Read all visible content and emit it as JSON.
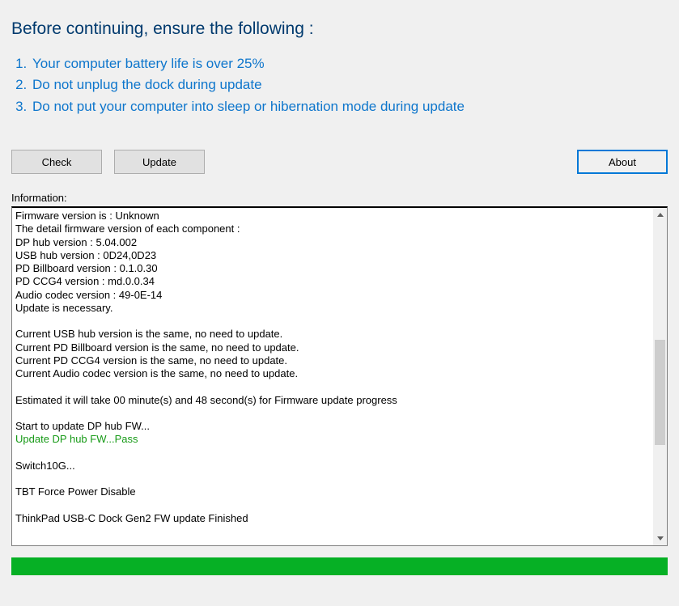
{
  "heading": "Before continuing, ensure the following :",
  "instructions": [
    "Your computer battery life is over 25%",
    "Do not unplug the dock during update",
    "Do not put your computer into sleep or hibernation mode during update"
  ],
  "buttons": {
    "check": "Check",
    "update": "Update",
    "about": "About"
  },
  "info_label": "Information:",
  "log": {
    "lines": [
      {
        "text": "Firmware version is : Unknown"
      },
      {
        "text": "The detail firmware version of each component :"
      },
      {
        "text": "DP hub version : 5.04.002"
      },
      {
        "text": "USB hub version : 0D24,0D23"
      },
      {
        "text": "PD Billboard version : 0.1.0.30"
      },
      {
        "text": "PD CCG4 version : md.0.0.34"
      },
      {
        "text": "Audio codec version : 49-0E-14"
      },
      {
        "text": "Update is necessary."
      },
      {
        "text": ""
      },
      {
        "text": "Current USB hub version is the same, no need to update."
      },
      {
        "text": "Current PD Billboard version is the same, no need to update."
      },
      {
        "text": "Current PD CCG4 version is the same, no need to update."
      },
      {
        "text": "Current Audio codec version is the same, no need to update."
      },
      {
        "text": ""
      },
      {
        "text": "Estimated it will take 00 minute(s) and 48 second(s) for Firmware update progress"
      },
      {
        "text": ""
      },
      {
        "text": "Start to update DP hub FW..."
      },
      {
        "text": "Update DP hub FW...Pass",
        "color": "green"
      },
      {
        "text": ""
      },
      {
        "text": "Switch10G..."
      },
      {
        "text": ""
      },
      {
        "text": "TBT Force Power Disable"
      },
      {
        "text": ""
      },
      {
        "text": "ThinkPad USB-C Dock Gen2 FW update Finished"
      }
    ]
  },
  "progress_percent": 100
}
